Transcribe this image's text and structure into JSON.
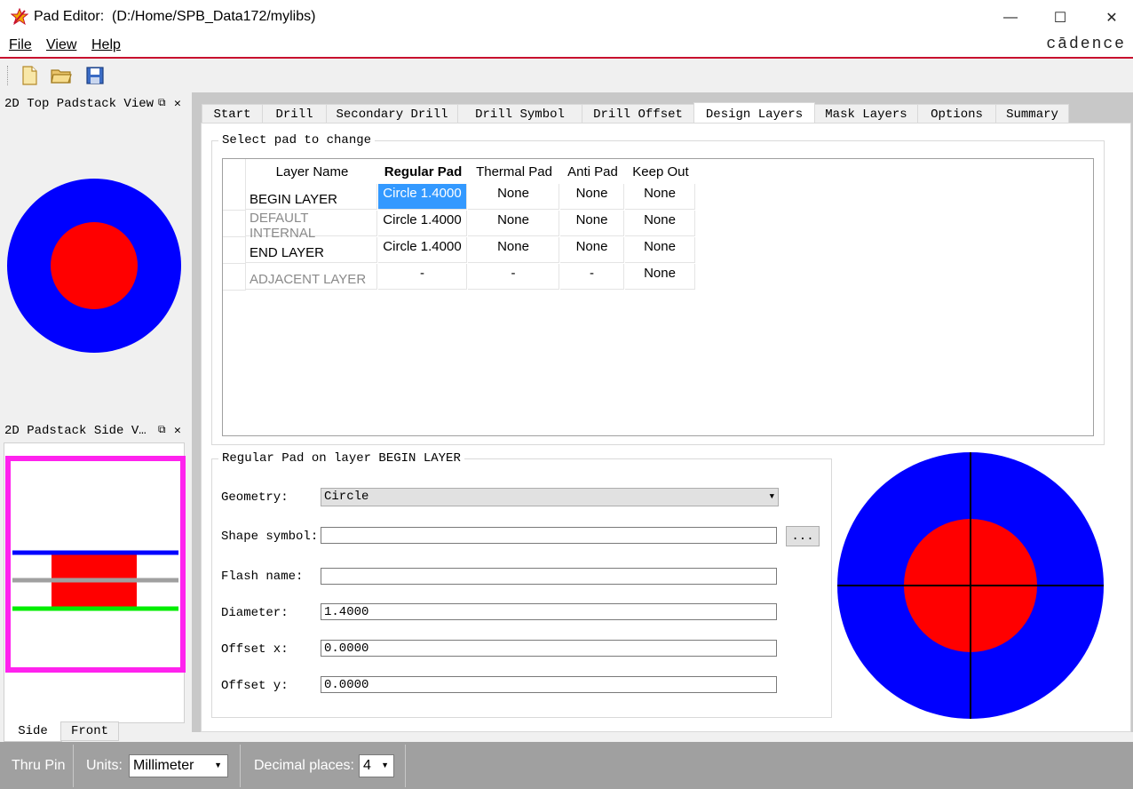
{
  "window": {
    "app_name": "Pad Editor:",
    "path": "(D:/Home/SPB_Data172/mylibs)",
    "minimize": "—",
    "maximize": "☐",
    "close": "✕"
  },
  "menu": {
    "file_label": "File",
    "view_label": "View",
    "help_label": "Help",
    "brand": "cādence"
  },
  "toolbar": {
    "new_icon": "new-file-icon",
    "open_icon": "open-folder-icon",
    "save_icon": "save-icon"
  },
  "left_panes": {
    "top_view_title": "2D Top Padstack View",
    "side_view_title": "2D Padstack Side V…",
    "pin_glyph": "⧉",
    "close_glyph": "✕",
    "side_tab": "Side",
    "front_tab": "Front"
  },
  "tabs": [
    "Start",
    "Drill",
    "Secondary Drill",
    "Drill Symbol",
    "Drill Offset",
    "Design Layers",
    "Mask Layers",
    "Options",
    "Summary"
  ],
  "active_tab": "Design Layers",
  "pad_table": {
    "group_title": "Select pad to change",
    "headers": [
      "Layer Name",
      "Regular Pad",
      "Thermal Pad",
      "Anti Pad",
      "Keep Out"
    ],
    "rows": [
      {
        "layer": "BEGIN LAYER",
        "regular": "Circle 1.4000",
        "thermal": "None",
        "anti": "None",
        "keepout": "None"
      },
      {
        "layer": "DEFAULT INTERNAL",
        "regular": "Circle 1.4000",
        "thermal": "None",
        "anti": "None",
        "keepout": "None"
      },
      {
        "layer": "END LAYER",
        "regular": "Circle 1.4000",
        "thermal": "None",
        "anti": "None",
        "keepout": "None"
      },
      {
        "layer": "ADJACENT LAYER",
        "regular": "-",
        "thermal": "-",
        "anti": "-",
        "keepout": "None"
      }
    ]
  },
  "pad_form": {
    "group_title": "Regular Pad on layer BEGIN LAYER",
    "geometry_label": "Geometry:",
    "geometry_value": "Circle",
    "shape_label": "Shape symbol:",
    "shape_value": "",
    "browse_label": "...",
    "flash_label": "Flash name:",
    "flash_value": "",
    "diameter_label": "Diameter:",
    "diameter_value": "1.4000",
    "offset_x_label": "Offset x:",
    "offset_x_value": "0.0000",
    "offset_y_label": "Offset y:",
    "offset_y_value": "0.0000"
  },
  "status": {
    "pin_type": "Thru Pin",
    "units_label": "Units:",
    "units_value": "Millimeter",
    "decimal_label": "Decimal places:",
    "decimal_value": "4"
  },
  "colors": {
    "pad_outer": "#0000ff",
    "pad_inner": "#ff0000",
    "selection": "#3399ff",
    "side_frame": "#ff22ee",
    "top_layer": "#0000ff",
    "internal_layer": "#a0a0a0",
    "bottom_layer": "#00ee00",
    "accent": "#c8102e"
  }
}
